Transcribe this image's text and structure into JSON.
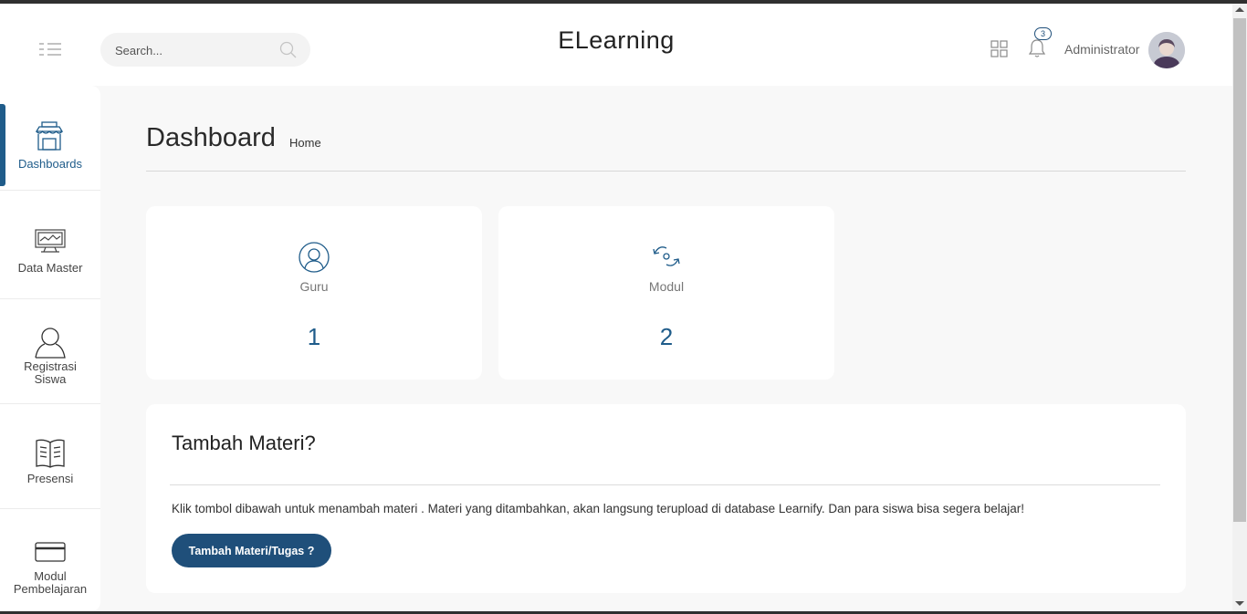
{
  "header": {
    "brand": "ELearning",
    "search_placeholder": "Search...",
    "notification_count": "3",
    "username": "Administrator"
  },
  "sidebar": {
    "items": [
      {
        "label": "Dashboards",
        "icon": "shop-icon",
        "active": true
      },
      {
        "label": "Data Master",
        "icon": "monitor-chart-icon",
        "active": false
      },
      {
        "label": "Registrasi Siswa",
        "icon": "user-icon",
        "active": false
      },
      {
        "label": "Presensi",
        "icon": "book-icon",
        "active": false
      },
      {
        "label": "Modul Pembelajaran",
        "icon": "credit-card-icon",
        "active": false
      }
    ]
  },
  "page": {
    "title": "Dashboard",
    "breadcrumb": "Home"
  },
  "stats": [
    {
      "label": "Guru",
      "value": "1",
      "icon": "user-circle-icon"
    },
    {
      "label": "Modul",
      "value": "2",
      "icon": "refresh-icon"
    }
  ],
  "materi": {
    "title": "Tambah Materi?",
    "text": "Klik tombol dibawah untuk menambah materi . Materi yang ditambahkan, akan langsung terupload di database Learnify. Dan para siswa bisa segera belajar!",
    "button_label": "Tambah Materi/Tugas ?"
  },
  "colors": {
    "accent": "#1f5c8a",
    "button": "#1f4f7a",
    "background": "#f8f8f8"
  }
}
